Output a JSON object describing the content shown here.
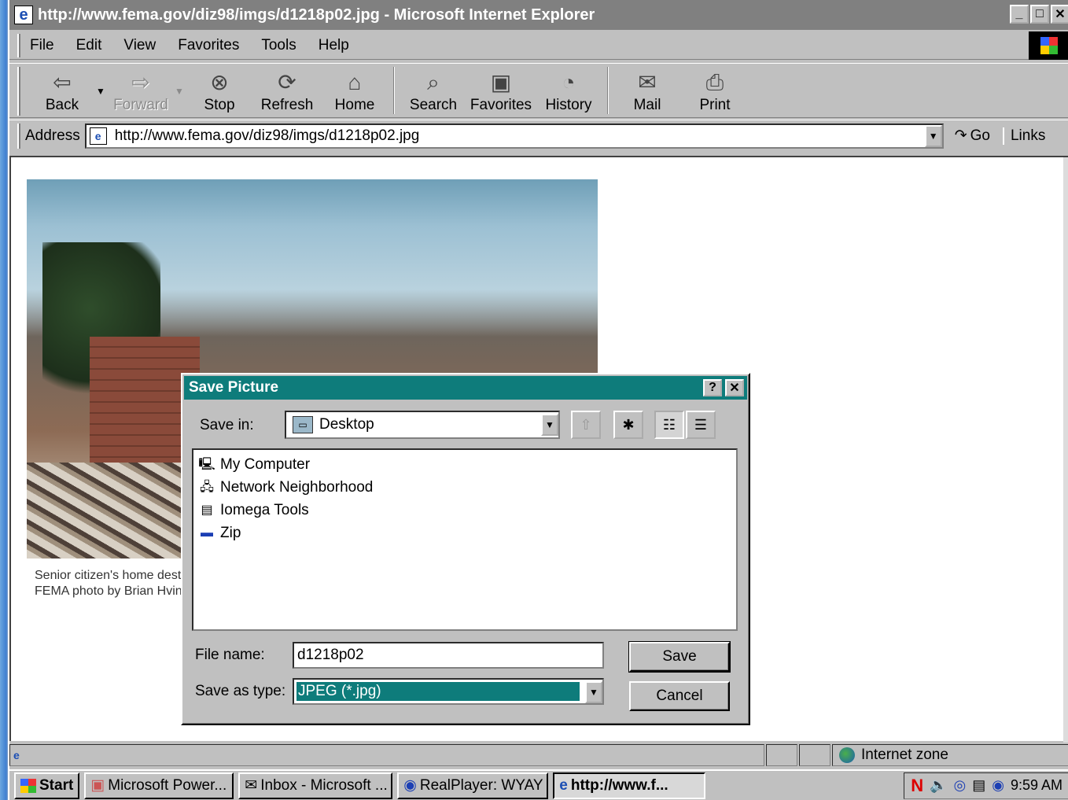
{
  "window": {
    "title": "http://www.fema.gov/diz98/imgs/d1218p02.jpg - Microsoft Internet Explorer",
    "caption_buttons": [
      "_",
      "□",
      "✕"
    ]
  },
  "menubar": [
    "File",
    "Edit",
    "View",
    "Favorites",
    "Tools",
    "Help"
  ],
  "toolbar": {
    "back": "Back",
    "forward": "Forward",
    "stop": "Stop",
    "refresh": "Refresh",
    "home": "Home",
    "search": "Search",
    "favorites": "Favorites",
    "history": "History",
    "mail": "Mail",
    "print": "Print"
  },
  "address": {
    "label": "Address",
    "url": "http://www.fema.gov/diz98/imgs/d1218p02.jpg",
    "go": "Go",
    "links": "Links"
  },
  "page": {
    "caption_line1": "Senior citizen's home destroyed by tornado.",
    "caption_line2": "FEMA photo by Brian Hvinden"
  },
  "dialog": {
    "title": "Save Picture",
    "help_btn": "?",
    "close_btn": "✕",
    "save_in_label": "Save in:",
    "save_in_value": "Desktop",
    "files": [
      "My Computer",
      "Network Neighborhood",
      "Iomega Tools",
      "Zip"
    ],
    "file_name_label": "File name:",
    "file_name_value": "d1218p02",
    "save_type_label": "Save as type:",
    "save_type_value": "JPEG (*.jpg)",
    "save_button": "Save",
    "cancel_button": "Cancel"
  },
  "statusbar": {
    "zone": "Internet zone"
  },
  "taskbar": {
    "start": "Start",
    "items": [
      "Microsoft Power...",
      "Inbox - Microsoft ...",
      "RealPlayer: WYAY",
      "http://www.f..."
    ],
    "clock": "9:59 AM"
  },
  "colors": {
    "dialog_title_bg": "#0e7c7b",
    "window_face": "#c0c0c0"
  }
}
